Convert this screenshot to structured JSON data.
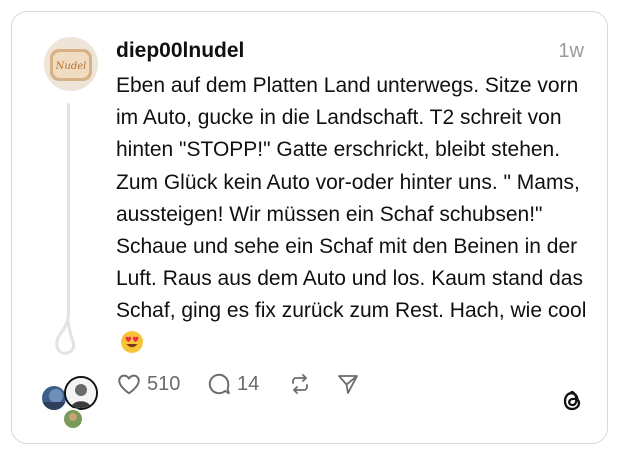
{
  "post": {
    "username": "diep00lnudel",
    "time": "1w",
    "text": "Eben auf dem Platten Land unterwegs. Sitze vorn im Auto, gucke in die Landschaft. T2 schreit von hinten \"STOPP!\" Gatte erschrickt, bleibt stehen. Zum Glück kein Auto vor-oder hinter uns. \" Mams, aussteigen! Wir müssen ein Schaf schubsen!\" Schaue und sehe ein Schaf mit den Beinen in der Luft. Raus aus dem Auto und los. Kaum stand das Schaf, ging es fix zurück zum Rest. Hach, wie cool",
    "emoji": "heart-eyes-emoji",
    "avatar_text": "Nudel"
  },
  "actions": {
    "likes": "510",
    "replies": "14"
  },
  "icons": {
    "like": "heart-icon",
    "reply": "comment-icon",
    "repost": "repost-icon",
    "share": "send-icon",
    "brand": "threads-logo-icon"
  },
  "colors": {
    "text": "#101010",
    "muted": "#9a9a9a",
    "icon": "#6b6b6b",
    "border": "#d9d9d9"
  }
}
